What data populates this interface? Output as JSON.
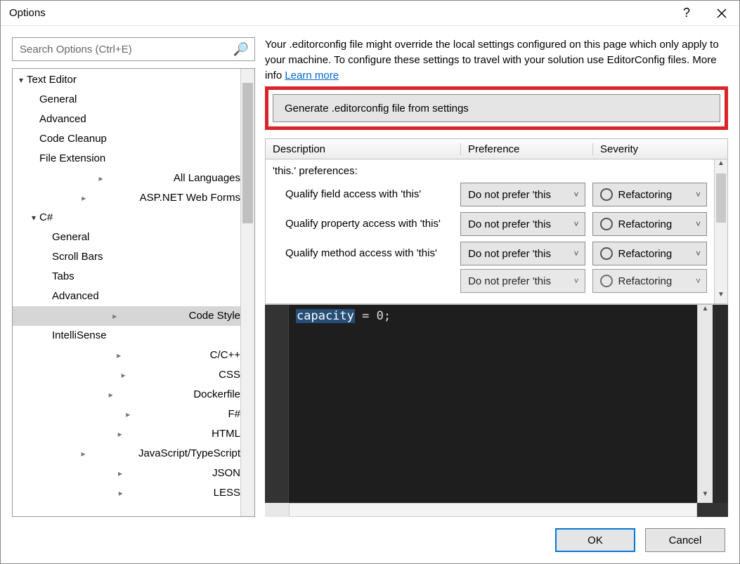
{
  "window": {
    "title": "Options"
  },
  "search": {
    "placeholder": "Search Options (Ctrl+E)"
  },
  "tree": [
    {
      "label": "Text Editor",
      "depth": 0,
      "arrow": "down"
    },
    {
      "label": "General",
      "depth": 1,
      "arrow": "none"
    },
    {
      "label": "Advanced",
      "depth": 1,
      "arrow": "none"
    },
    {
      "label": "Code Cleanup",
      "depth": 1,
      "arrow": "none"
    },
    {
      "label": "File Extension",
      "depth": 1,
      "arrow": "none"
    },
    {
      "label": "All Languages",
      "depth": 1,
      "arrow": "right"
    },
    {
      "label": "ASP.NET Web Forms",
      "depth": 1,
      "arrow": "right"
    },
    {
      "label": "C#",
      "depth": 1,
      "arrow": "down"
    },
    {
      "label": "General",
      "depth": 2,
      "arrow": "none"
    },
    {
      "label": "Scroll Bars",
      "depth": 2,
      "arrow": "none"
    },
    {
      "label": "Tabs",
      "depth": 2,
      "arrow": "none"
    },
    {
      "label": "Advanced",
      "depth": 2,
      "arrow": "none"
    },
    {
      "label": "Code Style",
      "depth": 2,
      "arrow": "right",
      "selected": true
    },
    {
      "label": "IntelliSense",
      "depth": 2,
      "arrow": "none"
    },
    {
      "label": "C/C++",
      "depth": 1,
      "arrow": "right"
    },
    {
      "label": "CSS",
      "depth": 1,
      "arrow": "right"
    },
    {
      "label": "Dockerfile",
      "depth": 1,
      "arrow": "right"
    },
    {
      "label": "F#",
      "depth": 1,
      "arrow": "right"
    },
    {
      "label": "HTML",
      "depth": 1,
      "arrow": "right"
    },
    {
      "label": "JavaScript/TypeScript",
      "depth": 1,
      "arrow": "right"
    },
    {
      "label": "JSON",
      "depth": 1,
      "arrow": "right"
    },
    {
      "label": "LESS",
      "depth": 1,
      "arrow": "right"
    }
  ],
  "info": {
    "text": "Your .editorconfig file might override the local settings configured on this page which only apply to your machine. To configure these settings to travel with your solution use EditorConfig files. More info   ",
    "link": "Learn more"
  },
  "generate_btn": "Generate .editorconfig file from settings",
  "headers": {
    "desc": "Description",
    "pref": "Preference",
    "sev": "Severity"
  },
  "group": "'this.' preferences:",
  "rows": [
    {
      "desc": "Qualify field access with 'this'",
      "pref": "Do not prefer 'this",
      "sev": "Refactoring"
    },
    {
      "desc": "Qualify property access with 'this'",
      "pref": "Do not prefer 'this",
      "sev": "Refactoring"
    },
    {
      "desc": "Qualify method access with 'this'",
      "pref": "Do not prefer 'this",
      "sev": "Refactoring"
    },
    {
      "desc": "",
      "pref": "Do not prefer 'this",
      "sev": "Refactoring"
    }
  ],
  "code": {
    "selected": "capacity",
    "rest": " = 0;"
  },
  "buttons": {
    "ok": "OK",
    "cancel": "Cancel"
  }
}
